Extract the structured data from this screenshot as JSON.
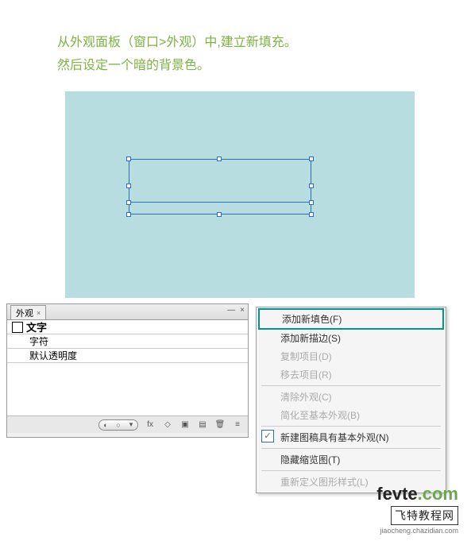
{
  "instructions": {
    "line1": "从外观面板（窗口>外观）中,建立新填充。",
    "line2": "然后设定一个暗的背景色。"
  },
  "panel": {
    "tab_label": "外观",
    "row_text": "文字",
    "sub_char": "字符",
    "sub_opacity": "默认透明度"
  },
  "menu": {
    "add_fill": "添加新填色(F)",
    "add_stroke": "添加新描边(S)",
    "duplicate": "复制项目(D)",
    "remove": "移去项目(R)",
    "clear": "清除外观(C)",
    "reduce": "简化至基本外观(B)",
    "basic": "新建图稿具有基本外观(N)",
    "hide_thumb": "隐藏缩览图(T)",
    "redefine": "重新定义图形样式(L)"
  },
  "watermark": {
    "brand_head": "fevte",
    "brand_tail": ".com",
    "cn": "飞特教程网",
    "sub": "jiaocheng.chazidian.com"
  }
}
